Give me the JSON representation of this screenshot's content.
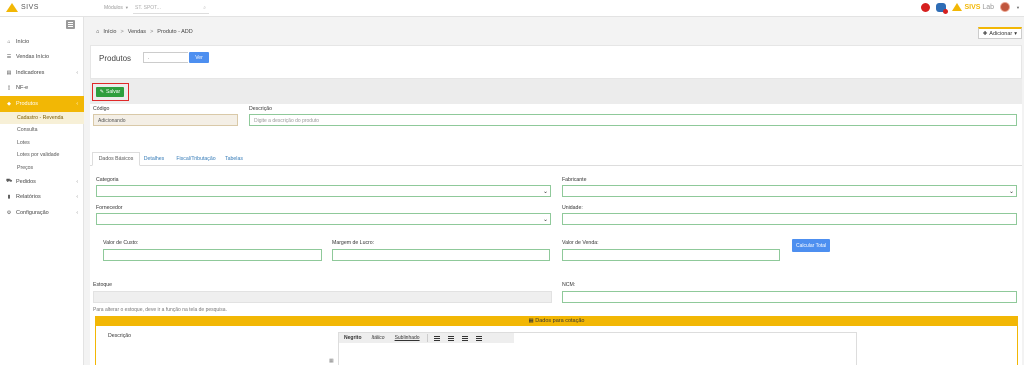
{
  "app": {
    "brand": "SIVS"
  },
  "topbar": {
    "module_label": "Módulos",
    "search_placeholder": "ST. SPOT...",
    "lab_name_bold": "SIVS",
    "lab_name_light": " Lab"
  },
  "sidebar": {
    "items": [
      {
        "label": "Início",
        "icon": "home-icon"
      },
      {
        "label": "Vendas Início",
        "icon": "list-icon"
      },
      {
        "label": "Indicadores",
        "icon": "chart-icon",
        "arrow": "‹"
      },
      {
        "label": "NF-e",
        "icon": "file-icon"
      },
      {
        "label": "Produtos",
        "icon": "tag-icon",
        "arrow": "‹"
      }
    ],
    "subitems": [
      {
        "label": "Cadastro - Revenda"
      },
      {
        "label": "Consulta"
      },
      {
        "label": "Lotes"
      },
      {
        "label": "Lotes por validade"
      },
      {
        "label": "Preços"
      }
    ],
    "items_after": [
      {
        "label": "Pedidos",
        "icon": "cart-icon",
        "arrow": "‹"
      },
      {
        "label": "Relatórios",
        "icon": "report-icon",
        "arrow": "‹"
      },
      {
        "label": "Configuração",
        "icon": "cogs-icon",
        "arrow": "‹"
      }
    ]
  },
  "breadcrumb": {
    "home": "Início",
    "sep": ">",
    "section": "Vendas",
    "page": "Produto - ADD"
  },
  "header": {
    "add_label": "Adicionar"
  },
  "filter": {
    "title": "Produtos",
    "value": ".",
    "button": "Ver"
  },
  "toolbar": {
    "save_label": "Salvar"
  },
  "form": {
    "codigo_label": "Código",
    "codigo_value": "Adicionando",
    "descricao_label": "Descrição",
    "descricao_placeholder": "Digite a descrição do produto",
    "tabs": [
      "Dados Básicos",
      "Detalhes",
      "Fiscal/Tributação",
      "Tabelas"
    ],
    "categoria_label": "Categoria",
    "fabricante_label": "Fabricante",
    "fornecedor_label": "Fornecedor",
    "unidade_label": "Unidade:",
    "valor_custo_label": "Valor de Custo:",
    "margem_label": "Margem de Lucro:",
    "valor_venda_label": "Valor de Venda:",
    "calc_button": "Calcular Total",
    "estoque_label": "Estoque",
    "ncm_label": "NCM:",
    "estoque_hint": "Para alterar o estoque, deve ir a função na tela de pesquisa."
  },
  "quote": {
    "title": "Dados para cotação",
    "descricao_label": "Descrição",
    "toolbar": {
      "bold": "Negrito",
      "italic": "Itálico",
      "underline": "Sublinhado"
    }
  },
  "colors": {
    "accent": "#f2b705",
    "primary": "#4d8ff0",
    "success": "#2e9e3d",
    "highlight": "#e02828"
  }
}
